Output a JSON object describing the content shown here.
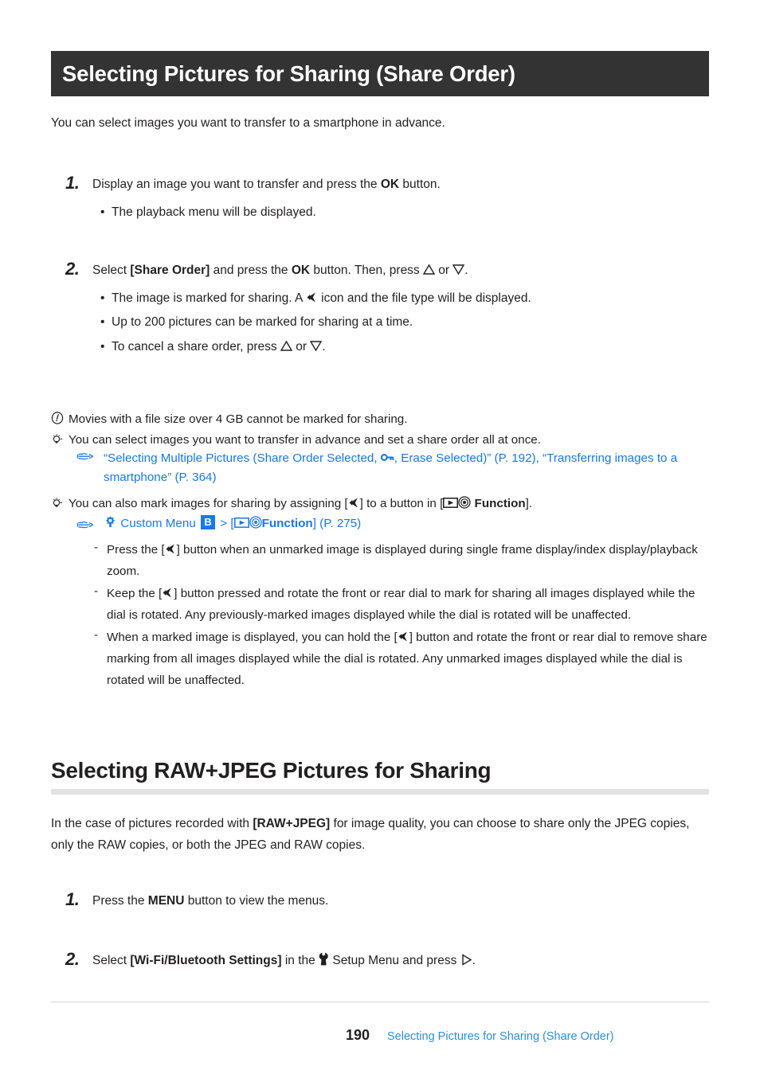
{
  "header": {
    "title": "Selecting Pictures for Sharing (Share Order)"
  },
  "intro": "You can select images you want to transfer to a smartphone in advance.",
  "steps_1": [
    {
      "number": "1.",
      "text_a": "Display an image you want to transfer and press the ",
      "bold": "OK",
      "text_b": " button.",
      "bullets": [
        {
          "text": "The playback menu will be displayed."
        }
      ]
    },
    {
      "number": "2.",
      "text_a": "Select ",
      "bold": "[Share Order]",
      "text_b": " and press the ",
      "bold2": "OK",
      "text_c": " button. Then, press ",
      "icon_up": "triangle-up-icon",
      "text_d": " or ",
      "icon_down": "triangle-down-icon",
      "text_e": ".",
      "bullets": [
        {
          "pre": "The image is marked for sharing. A ",
          "icon": "share-icon",
          "post": " icon and the file type will be displayed."
        },
        {
          "pre": "Up to 200 pictures can be marked for sharing at a time.",
          "icon": "",
          "post": ""
        },
        {
          "pre": "To cancel a share order, press ",
          "icon": "triangle-up-down-icon",
          "post": "."
        }
      ]
    }
  ],
  "notes": {
    "caution": {
      "icon": "exclamation-circle-icon",
      "text": "Movies with a file size over 4 GB cannot be marked for sharing."
    },
    "tip1": {
      "icon": "lightbulb-icon",
      "text": "You can select images you want to transfer in advance and set a share order all at once.",
      "reference": {
        "hand_icon": "pointing-hand-icon",
        "link_a": "“Selecting Multiple Pictures (Share Order Selected, ",
        "key_icon": "key-icon",
        "link_b": ", Erase Selected)” (P. 192), “Transferring images to a smartphone” (P. 364)"
      }
    },
    "tip2": {
      "icon": "lightbulb-icon",
      "text_a": "You can also mark images for sharing by assigning [",
      "share_icon": "share-icon",
      "text_b": "] to a button in [",
      "play_icon": "playback-icon",
      "target_icon": "target-icon",
      "bold": " Function",
      "text_c": "].",
      "menu_path": {
        "hand_icon": "pointing-hand-icon",
        "gear_icon": "custom-menu-gear-icon",
        "menu_label": "Custom Menu",
        "badge": "B",
        "separator": ">",
        "open_bracket": "[",
        "play_icon": "playback-icon",
        "target_icon": "target-icon",
        "function_label": "Function",
        "close_bracket": "]",
        "page_ref": "(P. 275)"
      },
      "sub_items": [
        {
          "pre": "Press the [",
          "icon": "share-icon",
          "post": "] button when an unmarked image is displayed during single frame display/index display/playback zoom."
        },
        {
          "pre": "Keep the [",
          "icon": "share-icon",
          "post": "] button pressed and rotate the front or rear dial to mark for sharing all images displayed while the dial is rotated. Any previously-marked images displayed while the dial is rotated will be unaffected."
        },
        {
          "pre": "When a marked image is displayed, you can hold the [",
          "icon": "share-icon",
          "post": "] button and rotate the front or rear dial to remove share marking from all images displayed while the dial is rotated. Any unmarked images displayed while the dial is rotated will be unaffected."
        }
      ]
    }
  },
  "section2": {
    "heading": "Selecting RAW+JPEG Pictures for Sharing",
    "para_a": "In the case of pictures recorded with ",
    "para_bold": "[RAW+JPEG]",
    "para_b": " for image quality, you can choose to share only the JPEG copies, only the RAW copies, or both the JPEG and RAW copies.",
    "steps": [
      {
        "number": "1.",
        "text_a": "Press the ",
        "bold": "MENU",
        "text_b": " button to view the menus."
      },
      {
        "number": "2.",
        "text_a": "Select ",
        "bold": "[Wi-Fi/Bluetooth Settings]",
        "text_b": " in the ",
        "wrench_icon": "wrench-setup-icon",
        "text_c": " Setup Menu and press ",
        "arrow_icon": "triangle-right-icon",
        "text_d": "."
      }
    ]
  },
  "footer": {
    "page_number": "190",
    "running_title": "Selecting Pictures for Sharing (Share Order)"
  },
  "colors": {
    "header_bar": "#333333",
    "link_blue": "#1878f0",
    "footer_link": "#2b8ee0",
    "rule_gray": "#e2e2e2",
    "text": "#231f20"
  }
}
